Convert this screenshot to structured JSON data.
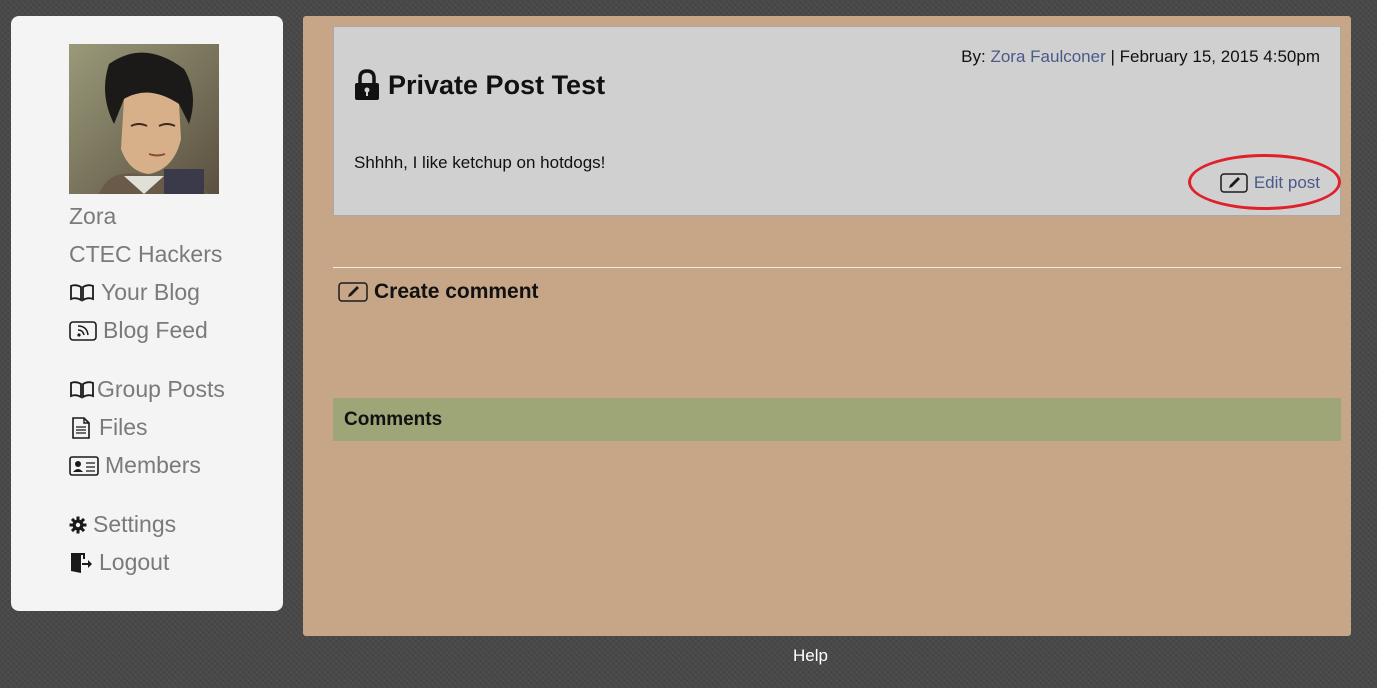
{
  "sidebar": {
    "user_name": "Zora",
    "group_name": "CTEC Hackers",
    "items": [
      {
        "label": "Your Blog",
        "icon": "open-book-icon"
      },
      {
        "label": "Blog Feed",
        "icon": "rss-feed-icon"
      },
      {
        "label": "Group Posts",
        "icon": "open-book-icon"
      },
      {
        "label": "Files",
        "icon": "document-icon"
      },
      {
        "label": "Members",
        "icon": "id-card-icon"
      },
      {
        "label": "Settings",
        "icon": "gear-icon"
      },
      {
        "label": "Logout",
        "icon": "logout-door-icon"
      }
    ]
  },
  "post": {
    "byline_prefix": "By:",
    "author": "Zora Faulconer",
    "separator": "|",
    "date": "February 15, 2015 4:50pm",
    "title": "Private Post Test",
    "body": "Shhhh, I like ketchup on hotdogs!",
    "edit_label": "Edit post"
  },
  "create_comment_label": "Create comment",
  "comments_heading": "Comments",
  "footer": {
    "help_label": "Help"
  },
  "colors": {
    "main_panel": "#c7a688",
    "post_box": "#d0d0d0",
    "comments_bar": "#9ea577",
    "link": "#4a5a8a",
    "annotation_ellipse": "#e0202a"
  }
}
